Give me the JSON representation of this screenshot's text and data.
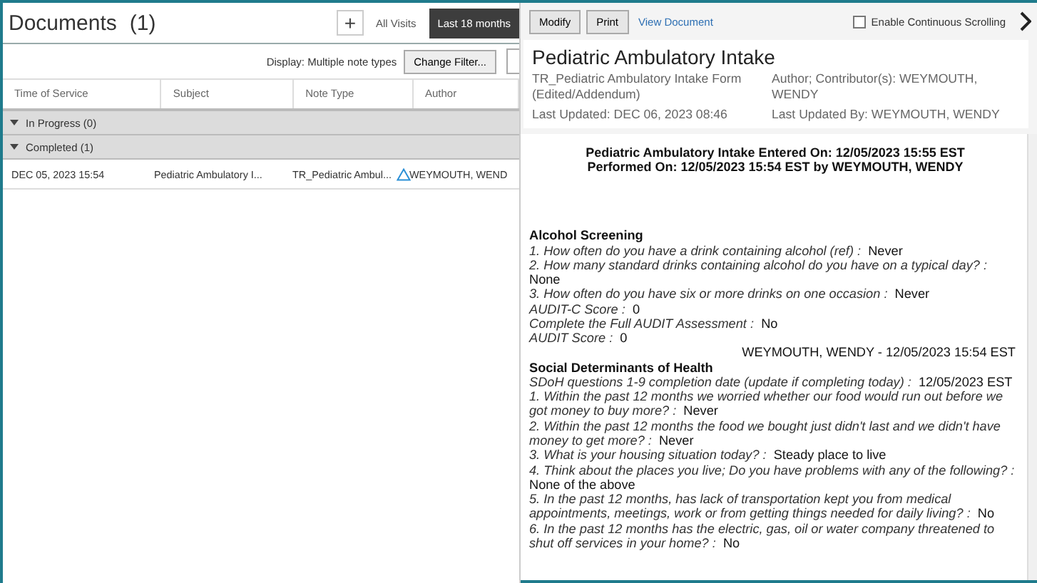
{
  "documents_panel": {
    "title": "Documents",
    "count": "(1)",
    "add_button": "+",
    "range_tabs": [
      {
        "label": "All Visits",
        "selected": false
      },
      {
        "label": "Last 18 months",
        "selected": true
      }
    ],
    "display_label": "Display: Multiple note types",
    "filter_button": "Change Filter...",
    "table": {
      "columns": [
        "Time of Service",
        "Subject",
        "Note Type",
        "Author"
      ],
      "groups": [
        {
          "label": "In Progress (0)",
          "expanded": true
        },
        {
          "label": "Completed (1)",
          "expanded": true,
          "rows": [
            {
              "time": "DEC 05, 2023 15:54",
              "subject": "Pediatric Ambulatory I...",
              "note_type": "TR_Pediatric Ambul...",
              "modified": true,
              "author": "WEYMOUTH, WEND"
            }
          ]
        }
      ]
    }
  },
  "viewer": {
    "toolbar": {
      "buttons": [
        "Modify",
        "Print"
      ],
      "link": "View Document",
      "continuous_scrolling": {
        "label": "Enable Continuous Scrolling",
        "checked": false
      }
    },
    "header": {
      "title": "Pediatric Ambulatory Intake",
      "form": "TR_Pediatric Ambulatory Intake Form (Edited/Addendum)",
      "author": "Author; Contributor(s): WEYMOUTH, WENDY",
      "last_updated": "Last Updated: DEC 06, 2023 08:46",
      "last_updated_by": "Last Updated By: WEYMOUTH, WENDY"
    },
    "document": {
      "heading_lines": [
        "Pediatric Ambulatory Intake Entered On:  12/05/2023 15:55 EST",
        "Performed On:  12/05/2023 15:54 EST by WEYMOUTH, WENDY"
      ],
      "sections": [
        {
          "title": "Alcohol Screening",
          "items": [
            {
              "question": "1. How often do you have a drink containing alcohol (ref) :",
              "answer": "Never"
            },
            {
              "question": "2. How many standard drinks containing alcohol do you have on a typical day? :",
              "answer": "None"
            },
            {
              "question": "3. How often do you have six or more drinks on one occasion :",
              "answer": "Never"
            },
            {
              "question": "AUDIT-C Score :",
              "answer": "0"
            },
            {
              "question": "Complete the Full AUDIT Assessment :",
              "answer": "No"
            },
            {
              "question": "AUDIT Score :",
              "answer": "0"
            }
          ],
          "signature": "WEYMOUTH, WENDY - 12/05/2023 15:54 EST"
        },
        {
          "title": "Social Determinants of Health",
          "items": [
            {
              "question": "SDoH questions 1-9 completion date (update if completing today) :",
              "answer": "12/05/2023 EST"
            },
            {
              "question": "1. Within the past 12 months we worried whether our food would run out before we got money to buy more? :",
              "answer": "Never"
            },
            {
              "question": "2. Within the past 12 months the food we bought just didn't last and we didn't have money to get more? :",
              "answer": "Never"
            },
            {
              "question": "3. What is your housing situation today? :",
              "answer": "Steady place to live"
            },
            {
              "question": "4. Think about the places you live; Do you have problems with any of the following? :",
              "answer": "None of the above"
            },
            {
              "question": "5. In the past 12 months, has lack of transportation kept you from medical appointments, meetings, work or from getting things needed for daily living? :",
              "answer": "No"
            },
            {
              "question": "6. In the past 12 months has the electric, gas, oil or water company threatened to shut off services in your home? :",
              "answer": "No"
            }
          ]
        }
      ]
    }
  }
}
